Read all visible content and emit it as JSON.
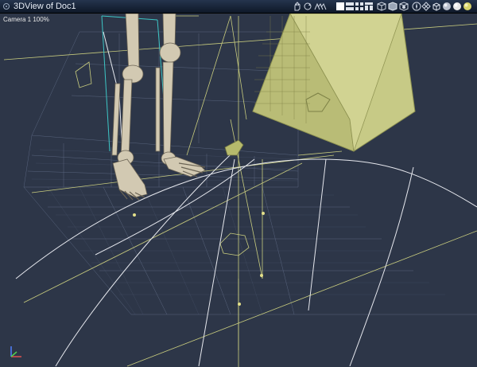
{
  "window": {
    "title": "3DView of Doc1"
  },
  "viewport": {
    "camera_label": "Camera 1 100%"
  },
  "toolbar": {
    "icons": [
      "hand-icon",
      "rotate-icon",
      "walk-icon",
      "single-view-icon",
      "split-view-icon",
      "quad-view-icon",
      "multi-view-icon",
      "render-mode-icon",
      "render-mode-icon",
      "render-mode-icon",
      "compass-icon",
      "grid-icon",
      "wireframe-cube-icon",
      "shaded-sphere-icon",
      "smooth-sphere-icon",
      "preview-sphere-icon"
    ]
  },
  "colors": {
    "background": "#2d3648",
    "grid": "#7c8aa8",
    "guide_lines": "#c8cc7e",
    "curves": "#ececec",
    "bone": "#d2c9b2",
    "pyramid": "#c7ca86",
    "axis_x": "#e05050",
    "axis_y": "#4fd04f",
    "axis_z": "#5080ff"
  }
}
